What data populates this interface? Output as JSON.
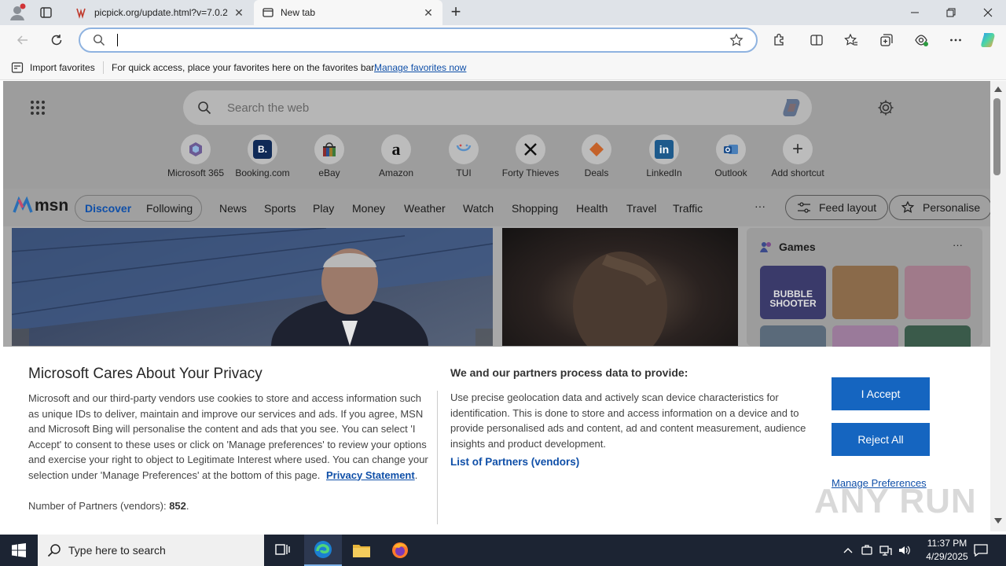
{
  "browser": {
    "tabs": [
      {
        "title": "picpick.org/update.html?v=7.0.2",
        "active": false
      },
      {
        "title": "New tab",
        "active": true
      }
    ],
    "new_tab_symbol": "+",
    "address_value": "",
    "favorites_bar": {
      "import_label": "Import favorites",
      "hint": "For quick access, place your favorites here on the favorites bar.",
      "manage_link": "Manage favorites now"
    }
  },
  "newtab": {
    "search_placeholder": "Search the web",
    "shortcuts": [
      {
        "label": "Microsoft 365",
        "icon": "microsoft-365-icon",
        "glyph": ""
      },
      {
        "label": "Booking.com",
        "icon": "booking-icon",
        "glyph": "B."
      },
      {
        "label": "eBay",
        "icon": "ebay-icon",
        "glyph": ""
      },
      {
        "label": "Amazon",
        "icon": "amazon-icon",
        "glyph": "a"
      },
      {
        "label": "TUI",
        "icon": "tui-icon",
        "glyph": ""
      },
      {
        "label": "Forty Thieves",
        "icon": "forty-thieves-icon",
        "glyph": ""
      },
      {
        "label": "Deals",
        "icon": "deals-icon",
        "glyph": ""
      },
      {
        "label": "LinkedIn",
        "icon": "linkedin-icon",
        "glyph": "in"
      },
      {
        "label": "Outlook",
        "icon": "outlook-icon",
        "glyph": ""
      },
      {
        "label": "Add shortcut",
        "icon": "add-icon",
        "glyph": "+"
      }
    ],
    "msn": {
      "logo": "msn",
      "segments": [
        "Discover",
        "Following"
      ],
      "nav": [
        "News",
        "Sports",
        "Play",
        "Money",
        "Weather",
        "Watch",
        "Shopping",
        "Health",
        "Travel",
        "Traffic"
      ],
      "more": "···",
      "feed_layout": "Feed layout",
      "personalise": "Personalise"
    },
    "games": {
      "title": "Games",
      "more": "···",
      "tile1_text": "BUBBLE SHOOTER"
    }
  },
  "privacy": {
    "title": "Microsoft Cares About Your Privacy",
    "body": "Microsoft and our third-party vendors use cookies to store and access information such as unique IDs to deliver, maintain and improve our services and ads. If you agree, MSN and Microsoft Bing will personalise the content and ads that you see. You can select 'I Accept' to consent to these uses or click on 'Manage preferences' to review your options and exercise your right to object to Legitimate Interest where used.  You can change your selection under 'Manage Preferences' at the bottom of this page.",
    "privacy_link": "Privacy Statement",
    "partners_label": "Number of Partners (vendors):",
    "partners_count": "852",
    "purposes_title": "We and our partners process data to provide:",
    "purposes_body": "Use precise geolocation data and actively scan device characteristics for identification. This is done to store and access information on a device and to provide personalised ads and content, ad and content measurement, audience insights and product development.",
    "vendors_link": "List of Partners (vendors)",
    "accept": "I Accept",
    "reject": "Reject All",
    "manage": "Manage Preferences"
  },
  "watermark": "ANY RUN",
  "taskbar": {
    "search_placeholder": "Type here to search",
    "time": "11:37 PM",
    "date": "4/29/2025"
  }
}
